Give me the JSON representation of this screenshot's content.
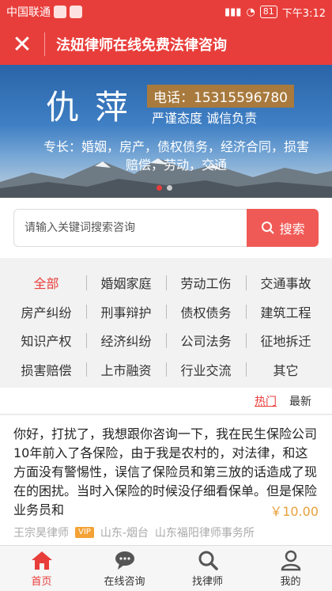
{
  "status_bar": {
    "carrier": "中国联通",
    "battery": "81",
    "time": "下午3:12"
  },
  "nav": {
    "close_icon": "close-icon",
    "title": "法妞律师在线免费法律咨询"
  },
  "banner": {
    "name": "仇萍",
    "phone": "电话：15315596780",
    "motto": "严谨态度 诚信负责",
    "specialty": "专长：婚姻，房产，债权债务，经济合同，损害赔偿，劳动，交通"
  },
  "search": {
    "placeholder": "请输入关键词搜索咨询",
    "button": "搜索"
  },
  "categories": [
    "全部",
    "婚姻家庭",
    "劳动工伤",
    "交通事故",
    "房产纠纷",
    "刑事辩护",
    "债权债务",
    "建筑工程",
    "知识产权",
    "经济纠纷",
    "公司法务",
    "征地拆迁",
    "损害赔偿",
    "上市融资",
    "行业交流",
    "其它"
  ],
  "filter": {
    "hot": "热门",
    "newest": "最新"
  },
  "question": {
    "text": "你好，打扰了，我想跟你咨询一下，我在民生保险公司10年前入了各保险，由于我是农村的，对法律，和这方面没有警惕性，误信了保险员和第三放的话造成了现在的困扰。当时入保险的时候没仔细看保单。但是保险业务员和",
    "price": "￥10.00",
    "lawyer": "王宗昊律师",
    "vip": "VIP",
    "location": "山东-烟台",
    "firm": "山东福阳律师事务所"
  },
  "tabbar": [
    {
      "label": "首页",
      "icon": "home-icon"
    },
    {
      "label": "在线咨询",
      "icon": "chat-icon"
    },
    {
      "label": "找律师",
      "icon": "search-icon"
    },
    {
      "label": "我的",
      "icon": "user-icon"
    }
  ],
  "colors": {
    "brand": "#e83e3b",
    "price": "#e8a03c"
  }
}
